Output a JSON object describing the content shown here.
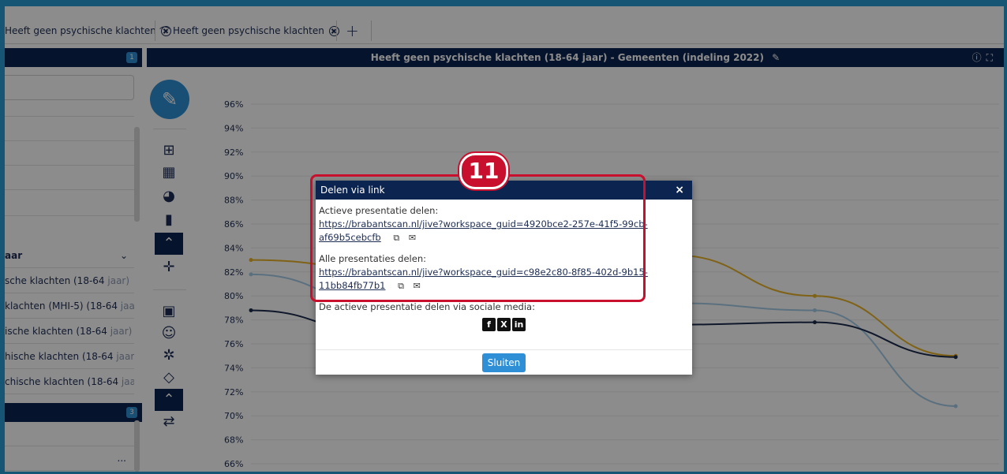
{
  "tabs": [
    {
      "label": "Heeft geen psychische klachten"
    },
    {
      "label": "Heeft geen psychische klachten"
    }
  ],
  "tab_add": "+",
  "left_panel": {
    "badge_top": "1",
    "badge_bottom": "3",
    "section_label": "aar",
    "items": [
      {
        "text": "sche klachten (18-64 ",
        "muted": "jaar)"
      },
      {
        "text": "klachten (MHI-5) (18-64 ",
        "muted": "jaar)"
      },
      {
        "text": "ische klachten (18-64 ",
        "muted": "jaar)"
      },
      {
        "text": "hische klachten (18-64 ",
        "muted": "jaar)"
      },
      {
        "text": "chische klachten (18-64 ",
        "muted": "jaar)"
      }
    ],
    "more": "..."
  },
  "main_header": {
    "title": "Heeft geen psychische klachten (18-64 jaar) - Gemeenten (indeling 2022)"
  },
  "chart_data": {
    "type": "line",
    "y_ticks": [
      "96%",
      "94%",
      "92%",
      "90%",
      "88%",
      "86%",
      "84%",
      "82%",
      "80%",
      "78%",
      "76%",
      "74%",
      "72%",
      "70%",
      "68%",
      "66%"
    ],
    "ylim": [
      65,
      97
    ],
    "x": [
      1,
      2,
      3,
      4,
      5,
      6
    ],
    "series": [
      {
        "color": "#e8b327",
        "values": [
          83.0,
          82.2,
          84.4,
          83.4,
          80.0,
          75.0
        ]
      },
      {
        "color": "#a6cde8",
        "values": [
          81.8,
          79.0,
          80.0,
          79.4,
          78.8,
          70.8
        ]
      },
      {
        "color": "#1c2b4e",
        "values": [
          78.8,
          76.6,
          77.2,
          77.6,
          77.8,
          74.9
        ]
      }
    ]
  },
  "modal": {
    "title": "Delen via link",
    "close": "×",
    "active_label": "Actieve presentatie delen:",
    "active_link_1": "https://brabantscan.nl/jive?workspace_guid=4920bce2-257e-41f5-99cb-",
    "active_link_2": "af69b5cebcfb",
    "all_label": "Alle presentaties delen:",
    "all_link_1": "https://brabantscan.nl/jive?workspace_guid=c98e2c80-8f85-402d-9b15-",
    "all_link_2": "11bb84fb77b1",
    "social_label": "De actieve presentatie delen via sociale media:",
    "button": "Sluiten"
  },
  "step_number": "11"
}
